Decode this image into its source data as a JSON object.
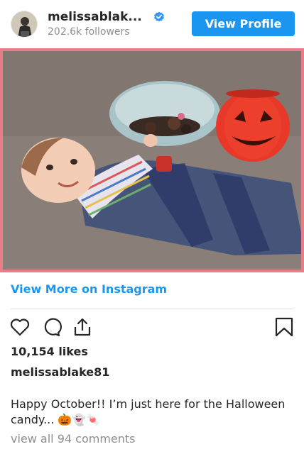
{
  "header": {
    "username": "melissablak...",
    "followers": "202.6k followers",
    "view_profile_label": "View Profile"
  },
  "post": {
    "view_more_label": "View More on Instagram",
    "likes": "10,154 likes",
    "caption_username": "melissablake81",
    "caption_text": "Happy October!! I’m just here for the Halloween candy... 🎃👻🍬",
    "comments_link": "view all 94 comments"
  },
  "icons": [
    "verified-badge-icon",
    "heart-icon",
    "comment-icon",
    "share-icon",
    "bookmark-icon"
  ],
  "colors": {
    "accent": "#1a95f0",
    "text": "#262626",
    "muted": "#8e8e8e",
    "photo_border": "#e87d88"
  }
}
